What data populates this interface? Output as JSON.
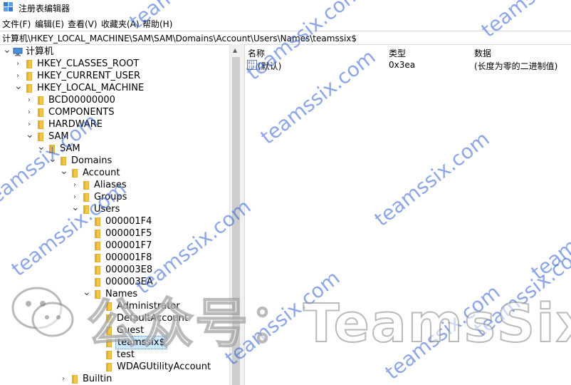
{
  "window": {
    "title": "注册表编辑器",
    "app_icon": "registry-editor-icon"
  },
  "menu": [
    "文件(F)",
    "编辑(E)",
    "查看(V)",
    "收藏夹(A)",
    "帮助(H)"
  ],
  "address": "计算机\\HKEY_LOCAL_MACHINE\\SAM\\SAM\\Domains\\Account\\Users\\Names\\teamssix$",
  "tree": [
    {
      "label": "计算机",
      "level": 0,
      "state": "expanded",
      "icon": "computer-icon"
    },
    {
      "label": "HKEY_CLASSES_ROOT",
      "level": 1,
      "state": "collapsed",
      "icon": "folder-icon"
    },
    {
      "label": "HKEY_CURRENT_USER",
      "level": 1,
      "state": "collapsed",
      "icon": "folder-icon"
    },
    {
      "label": "HKEY_LOCAL_MACHINE",
      "level": 1,
      "state": "expanded",
      "icon": "folder-icon"
    },
    {
      "label": "BCD00000000",
      "level": 2,
      "state": "collapsed",
      "icon": "folder-icon"
    },
    {
      "label": "COMPONENTS",
      "level": 2,
      "state": "collapsed",
      "icon": "folder-icon"
    },
    {
      "label": "HARDWARE",
      "level": 2,
      "state": "collapsed",
      "icon": "folder-icon"
    },
    {
      "label": "SAM",
      "level": 2,
      "state": "expanded",
      "icon": "folder-icon"
    },
    {
      "label": "SAM",
      "level": 3,
      "state": "expanded",
      "icon": "folder-icon"
    },
    {
      "label": "Domains",
      "level": 4,
      "state": "expanded",
      "icon": "folder-icon"
    },
    {
      "label": "Account",
      "level": 5,
      "state": "expanded",
      "icon": "folder-icon"
    },
    {
      "label": "Aliases",
      "level": 6,
      "state": "collapsed",
      "icon": "folder-icon"
    },
    {
      "label": "Groups",
      "level": 6,
      "state": "collapsed",
      "icon": "folder-icon"
    },
    {
      "label": "Users",
      "level": 6,
      "state": "expanded",
      "icon": "folder-icon"
    },
    {
      "label": "000001F4",
      "level": 7,
      "state": "none",
      "icon": "folder-icon"
    },
    {
      "label": "000001F5",
      "level": 7,
      "state": "none",
      "icon": "folder-icon"
    },
    {
      "label": "000001F7",
      "level": 7,
      "state": "none",
      "icon": "folder-icon"
    },
    {
      "label": "000001F8",
      "level": 7,
      "state": "none",
      "icon": "folder-icon"
    },
    {
      "label": "000003E8",
      "level": 7,
      "state": "none",
      "icon": "folder-icon"
    },
    {
      "label": "000003EA",
      "level": 7,
      "state": "none",
      "icon": "folder-icon"
    },
    {
      "label": "Names",
      "level": 7,
      "state": "expanded",
      "icon": "folder-icon"
    },
    {
      "label": "Administrator",
      "level": 8,
      "state": "none",
      "icon": "folder-icon"
    },
    {
      "label": "DefaultAccount",
      "level": 8,
      "state": "none",
      "icon": "folder-icon"
    },
    {
      "label": "Guest",
      "level": 8,
      "state": "none",
      "icon": "folder-icon"
    },
    {
      "label": "teamssix$",
      "level": 8,
      "state": "none",
      "icon": "folder-icon",
      "selected": true
    },
    {
      "label": "test",
      "level": 8,
      "state": "none",
      "icon": "folder-icon"
    },
    {
      "label": "WDAGUtilityAccount",
      "level": 8,
      "state": "none",
      "icon": "folder-icon"
    },
    {
      "label": "Builtin",
      "level": 5,
      "state": "collapsed",
      "icon": "folder-icon"
    }
  ],
  "list": {
    "columns": [
      "名称",
      "类型",
      "数据"
    ],
    "rows": [
      {
        "name": "(默认)",
        "type": "0x3ea",
        "data": "(长度为零的二进制值)",
        "icon": "binary-value-icon"
      }
    ]
  },
  "watermark": {
    "text": "teamssix.com",
    "banner": "公众号：TeamsSix",
    "color": "#2f5fd6"
  }
}
